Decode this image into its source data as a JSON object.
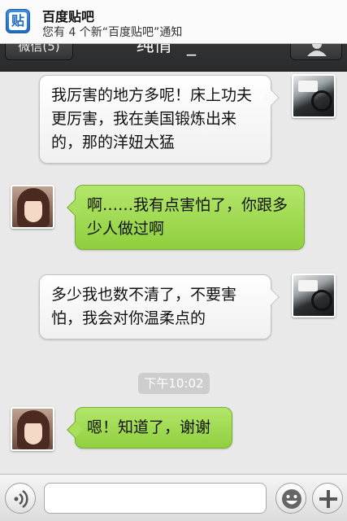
{
  "notification": {
    "app_icon_glyph": "贴",
    "title": "百度贴吧",
    "body": "您有 4 个新“百度贴吧”通知"
  },
  "navbar": {
    "back_label": "微信(5)",
    "title": "纯情^_^",
    "profile_icon": "person-icon"
  },
  "messages": [
    {
      "side": "right",
      "avatar": "car-interior-photo",
      "text": "我厉害的地方多呢！床上功夫更厉害，我在美国锻炼出来的，那的洋妞太猛"
    },
    {
      "side": "left",
      "avatar": "girl-photo",
      "text": "啊……我有点害怕了，你跟多少人做过啊"
    },
    {
      "side": "right",
      "avatar": "car-interior-photo",
      "text": "多少我也数不清了，不要害怕，我会对你温柔点的"
    },
    {
      "side": "left",
      "avatar": "girl-photo",
      "text": "嗯！知道了，谢谢"
    }
  ],
  "timestamp": "下午10:02",
  "inputbar": {
    "voice_icon": "voice-icon",
    "input_value": "",
    "emoji_icon": "smiley-icon",
    "more_icon": "plus-icon"
  },
  "colors": {
    "sent_bubble": "#ffffff",
    "received_bubble": "#a2dc52",
    "navbar": "#2f3032",
    "chat_bg": "#e9e9e9"
  }
}
